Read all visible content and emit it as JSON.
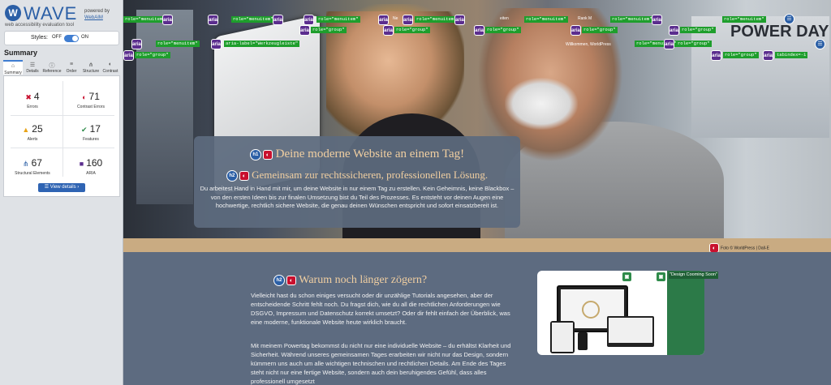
{
  "wave": {
    "logo_letter": "W",
    "name": "WAVE",
    "subtitle": "web accessibility evaluation tool",
    "powered_by": "powered by",
    "powered_link": "WebAIM",
    "styles_label": "Styles:",
    "styles_off": "OFF",
    "styles_on": "ON",
    "summary_title": "Summary",
    "tabs": [
      {
        "label": "Summary",
        "icon": "home-icon"
      },
      {
        "label": "Details",
        "icon": "list-icon"
      },
      {
        "label": "Reference",
        "icon": "info-icon"
      },
      {
        "label": "Order",
        "icon": "order-icon"
      },
      {
        "label": "Structure",
        "icon": "structure-icon"
      },
      {
        "label": "Contrast",
        "icon": "contrast-icon"
      }
    ],
    "counts": {
      "errors": {
        "value": "4",
        "label": "Errors"
      },
      "contrast": {
        "value": "71",
        "label": "Contrast Errors"
      },
      "alerts": {
        "value": "25",
        "label": "Alerts"
      },
      "features": {
        "value": "17",
        "label": "Features"
      },
      "structural": {
        "value": "67",
        "label": "Structural Elements"
      },
      "aria": {
        "value": "160",
        "label": "ARIA"
      }
    },
    "view_details": "View details ›",
    "colors": {
      "accent": "#2b5fa6",
      "error": "#c8102e",
      "alert": "#e8a317",
      "feature": "#2e8b4a",
      "aria": "#5b2d8e"
    }
  },
  "hero": {
    "h1_badge": "h1",
    "h1": "Deine moderne Website an einem Tag!",
    "h2_badge": "h2",
    "h2": "Gemeinsam zur rechtssicheren, professionellen Lösung.",
    "text": "Du arbeitest Hand in Hand mit mir, um deine Website in nur einem Tag zu erstellen. Kein Geheimnis, keine Blackbox – von den ersten Ideen bis zur finalen Umsetzung bist du Teil des Prozesses. Es entsteht vor deinen Augen eine hochwertige, rechtlich sichere Website, die genau deinen Wünschen entspricht und sofort einsatzbereit ist.",
    "background_text": "POWER DAY",
    "credit": "Foto © WorldPress | Dall-E"
  },
  "nav_text": {
    "rank": "Rank M",
    "welcome": "Willkommen, WorldPress",
    "ne": "Ne",
    "sseiten": "eiten"
  },
  "tags": {
    "menuitem": "role=\"menuitem\"",
    "group": "role=\"group\"",
    "werkzeugleiste": "aria-label=\"Werkzeugleiste\"",
    "tabindex": "tabindex=-1"
  },
  "section": {
    "h2_badge": "h2",
    "heading": "Warum noch länger zögern?",
    "p1": "Vielleicht hast du schon einiges versucht oder dir unzählige Tutorials angesehen, aber der entscheidende Schritt fehlt noch. Du fragst dich, wie du all die rechtlichen Anforderungen wie DSGVO, Impressum und Datenschutz korrekt umsetzt? Oder dir fehlt einfach der Überblick, was eine moderne, funktionale Website heute wirklich braucht.",
    "p2": "Mit meinem Powertag bekommst du nicht nur eine individuelle Website – du erhältst Klarheit und Sicherheit. Während unseres gemeinsamen Tages erarbeiten wir nicht nur das Design, sondern kümmern uns auch um alle wichtigen technischen und rechtlichen Details. Am Ende des Tages steht nicht nur eine fertige Website, sondern auch dein beruhigendes Gefühl, dass alles professionell umgesetzt",
    "image_label": "\"Design Cooming Soon\""
  }
}
